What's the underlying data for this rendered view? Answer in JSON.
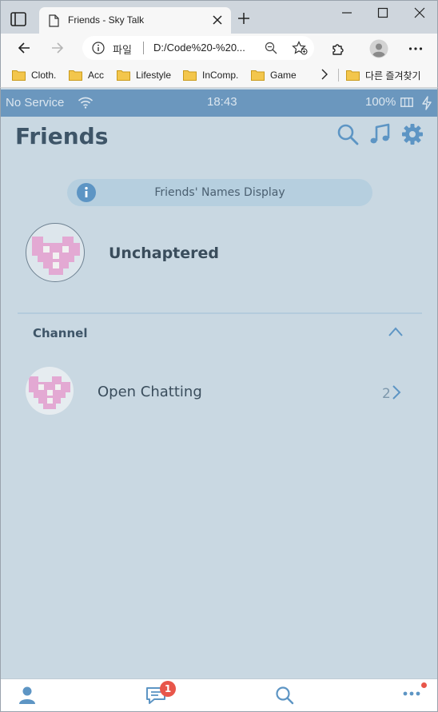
{
  "browser": {
    "tab_title": "Friends - Sky Talk",
    "url_scheme": "파일",
    "url": "D:/Code%20-%20...",
    "bookmarks": [
      "Cloth.",
      "Acc",
      "Lifestyle",
      "InComp.",
      "Game"
    ],
    "other_bookmarks": "다른 즐겨찾기"
  },
  "status_bar": {
    "carrier": "No Service",
    "time": "18:43",
    "battery": "100%"
  },
  "header": {
    "title": "Friends"
  },
  "notice": {
    "text": "Friends' Names Display"
  },
  "profile": {
    "name": "Unchaptered"
  },
  "channel_section": {
    "title": "Channel",
    "items": [
      {
        "name": "Open Chatting",
        "count": "2"
      }
    ]
  },
  "bottom_nav": {
    "chats_badge": "1"
  },
  "colors": {
    "app_bg": "#c9d8e2",
    "status_bar": "#6b97be",
    "accent": "#5d95c4",
    "badge": "#e8564a",
    "avatar_pink": "#e3a9d3"
  }
}
